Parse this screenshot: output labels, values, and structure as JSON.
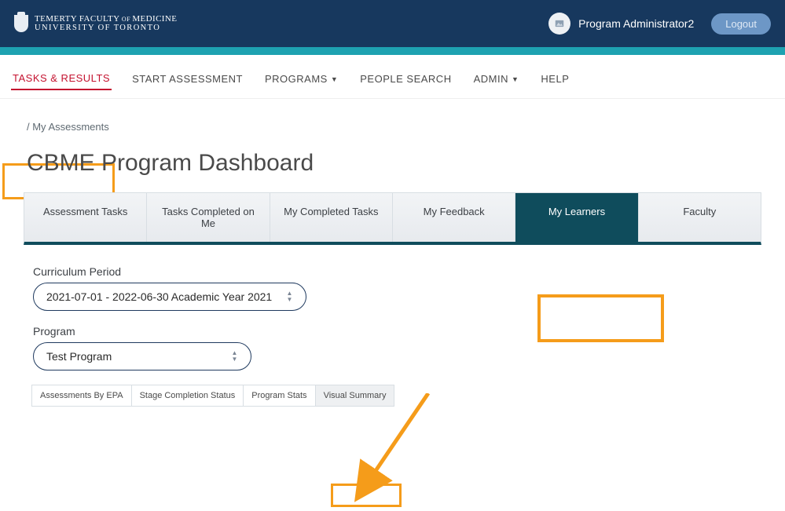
{
  "header": {
    "org_line1_a": "TEMERTY FACULTY",
    "org_line1_small": " OF ",
    "org_line1_b": "MEDICINE",
    "org_line2": "UNIVERSITY OF TORONTO",
    "username": "Program Administrator2",
    "logout_label": "Logout"
  },
  "nav": {
    "tasks_results": "TASKS & RESULTS",
    "start_assessment": "START ASSESSMENT",
    "programs": "PROGRAMS",
    "people_search": "PEOPLE SEARCH",
    "admin": "ADMIN",
    "help": "HELP"
  },
  "breadcrumb": "/ My Assessments",
  "page_title": "CBME Program Dashboard",
  "tabs": {
    "assessment_tasks": "Assessment Tasks",
    "tasks_completed_on_me": "Tasks Completed on Me",
    "my_completed_tasks": "My Completed Tasks",
    "my_feedback": "My Feedback",
    "my_learners": "My Learners",
    "faculty": "Faculty"
  },
  "filters": {
    "curriculum_label": "Curriculum Period",
    "curriculum_value": "2021-07-01 - 2022-06-30 Academic Year 2021",
    "program_label": "Program",
    "program_value": "Test Program"
  },
  "subtabs": {
    "assessments_by_epa": "Assessments By EPA",
    "stage_completion": "Stage Completion Status",
    "program_stats": "Program Stats",
    "visual_summary": "Visual Summary"
  },
  "colors": {
    "highlight": "#f59c1a",
    "brand_navy": "#17385e",
    "teal": "#1ea2b1",
    "active_red": "#c4122f",
    "tab_active": "#0f4c5c"
  }
}
